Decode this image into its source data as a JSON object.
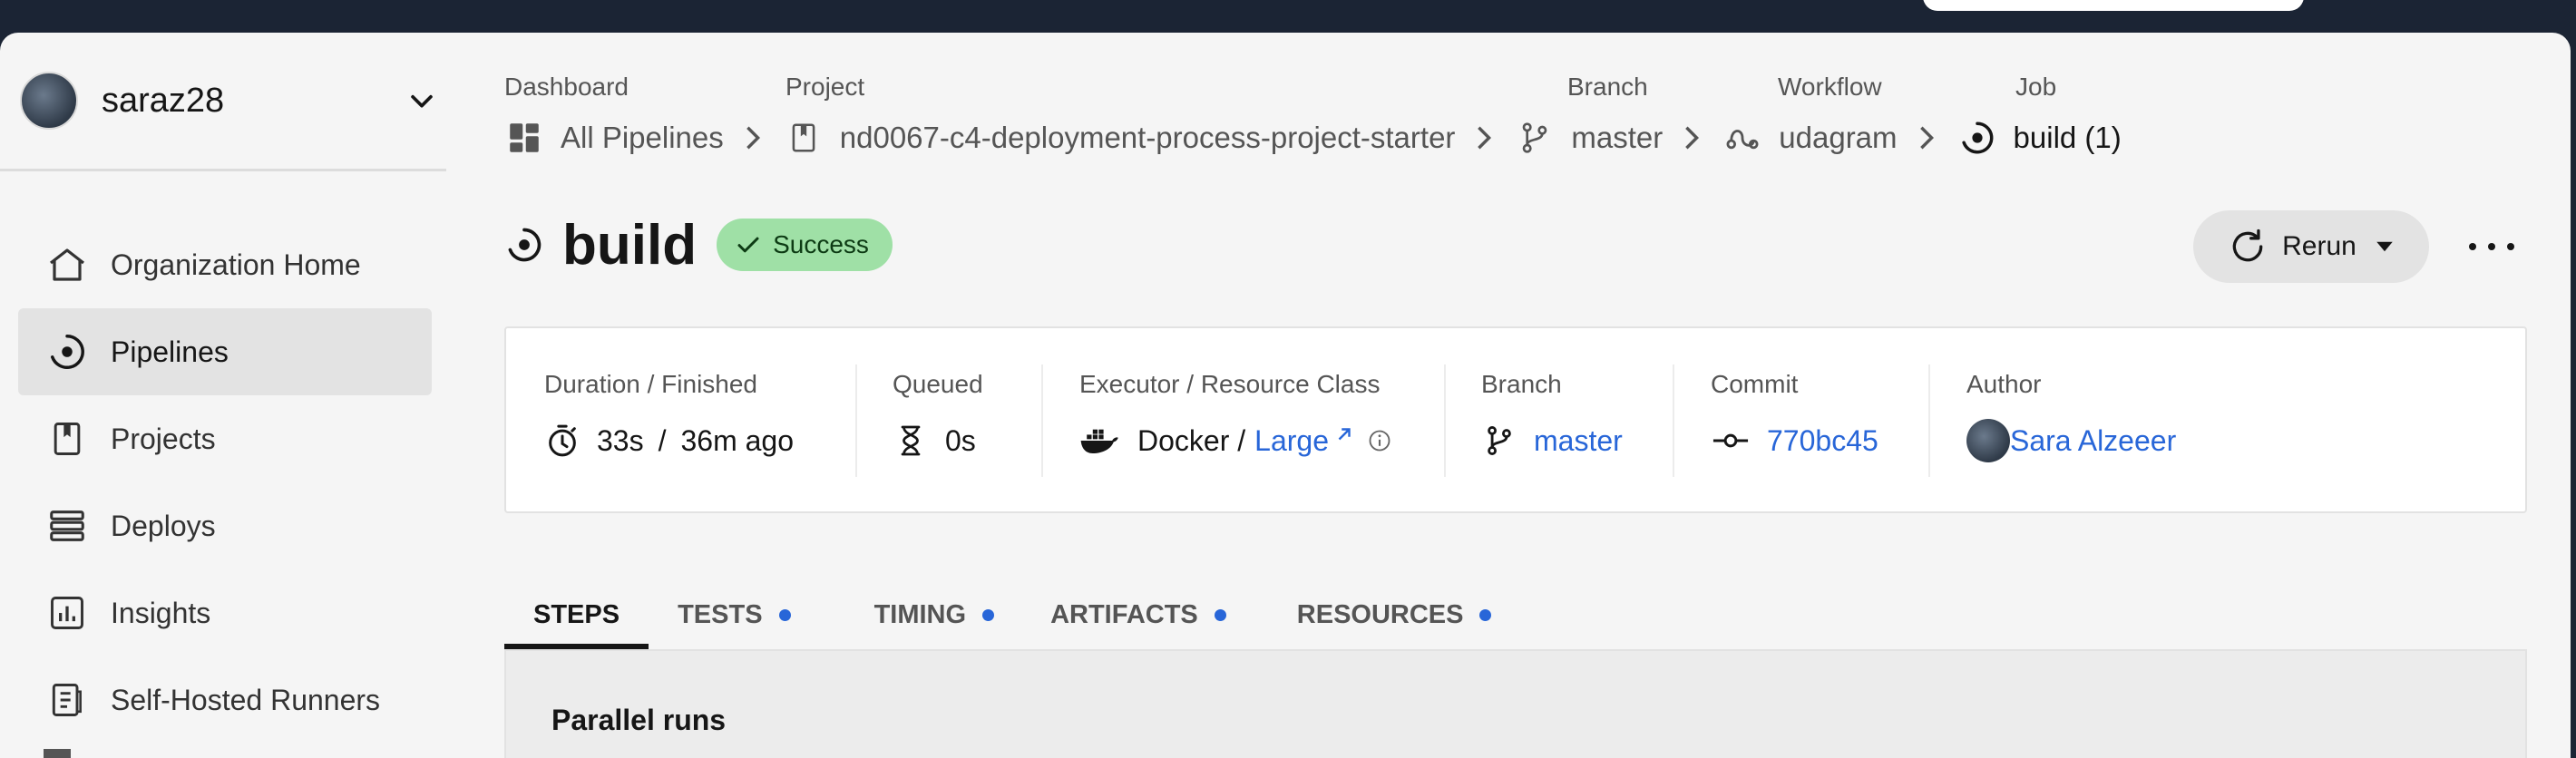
{
  "user": {
    "name": "saraz28"
  },
  "sidebar": {
    "items": [
      {
        "label": "Organization Home",
        "icon": "home-icon"
      },
      {
        "label": "Pipelines",
        "icon": "pipelines-icon",
        "active": true
      },
      {
        "label": "Projects",
        "icon": "project-icon"
      },
      {
        "label": "Deploys",
        "icon": "deploys-icon"
      },
      {
        "label": "Insights",
        "icon": "insights-icon"
      },
      {
        "label": "Self-Hosted Runners",
        "icon": "runners-icon"
      }
    ]
  },
  "breadcrumb": {
    "heads": {
      "dashboard": "Dashboard",
      "project": "Project",
      "branch": "Branch",
      "workflow": "Workflow",
      "job": "Job"
    },
    "items": {
      "dashboard": "All Pipelines",
      "project": "nd0067-c4-deployment-process-project-starter",
      "branch": "master",
      "workflow": "udagram",
      "job": "build (1)"
    }
  },
  "job": {
    "title": "build",
    "status": "Success",
    "rerun_label": "Rerun"
  },
  "details": {
    "duration": {
      "label": "Duration / Finished",
      "duration": "33s",
      "separator": "/",
      "finished": "36m ago"
    },
    "queued": {
      "label": "Queued",
      "value": "0s"
    },
    "executor": {
      "label": "Executor / Resource Class",
      "executor": "Docker /",
      "resource_class": "Large"
    },
    "branch": {
      "label": "Branch",
      "value": "master"
    },
    "commit": {
      "label": "Commit",
      "value": "770bc45"
    },
    "author": {
      "label": "Author",
      "value": "Sara Alzeeer"
    }
  },
  "tabs": [
    {
      "label": "STEPS",
      "active": true,
      "dot": false
    },
    {
      "label": "TESTS",
      "dot": true
    },
    {
      "label": "TIMING",
      "dot": true
    },
    {
      "label": "ARTIFACTS",
      "dot": true
    },
    {
      "label": "RESOURCES",
      "dot": true
    }
  ],
  "panel": {
    "title": "Parallel runs"
  },
  "colors": {
    "accent": "#2866d8",
    "success_bg": "#9fe0a6",
    "topbar": "#1b2434"
  }
}
